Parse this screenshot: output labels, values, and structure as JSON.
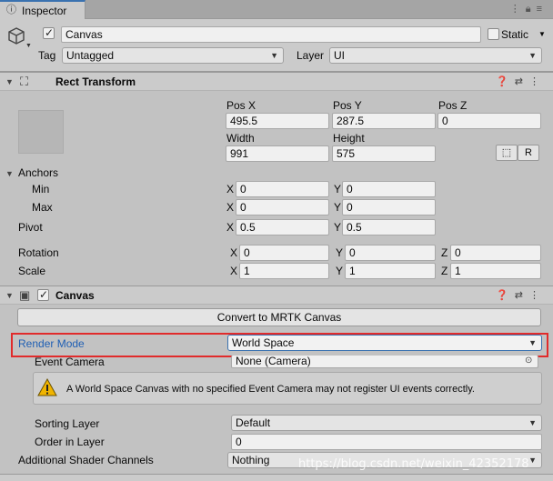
{
  "tab": {
    "label": "Inspector",
    "icon": "info-icon"
  },
  "header": {
    "object_name": "Canvas",
    "static_label": "Static",
    "tag_label": "Tag",
    "tag_value": "Untagged",
    "layer_label": "Layer",
    "layer_value": "UI"
  },
  "rect_transform": {
    "title": "Rect Transform",
    "pos_x_label": "Pos X",
    "pos_y_label": "Pos Y",
    "pos_z_label": "Pos Z",
    "pos_x": "495.5",
    "pos_y": "287.5",
    "pos_z": "0",
    "width_label": "Width",
    "height_label": "Height",
    "width": "991",
    "height": "575",
    "raw_button": "R",
    "anchors_label": "Anchors",
    "min_label": "Min",
    "max_label": "Max",
    "min_x": "0",
    "min_y": "0",
    "max_x": "0",
    "max_y": "0",
    "pivot_label": "Pivot",
    "pivot_x": "0.5",
    "pivot_y": "0.5",
    "rotation_label": "Rotation",
    "rot_x": "0",
    "rot_y": "0",
    "rot_z": "0",
    "scale_label": "Scale",
    "scale_x": "1",
    "scale_y": "1",
    "scale_z": "1",
    "x": "X",
    "y": "Y",
    "z": "Z"
  },
  "canvas": {
    "title": "Canvas",
    "convert_button": "Convert to MRTK Canvas",
    "render_mode_label": "Render Mode",
    "render_mode_value": "World Space",
    "event_camera_label": "Event Camera",
    "event_camera_value": "None (Camera)",
    "warning": "A World Space Canvas with no specified Event Camera may not register UI events correctly.",
    "sorting_layer_label": "Sorting Layer",
    "sorting_layer_value": "Default",
    "order_label": "Order in Layer",
    "order_value": "0",
    "shader_label": "Additional Shader Channels",
    "shader_value": "Nothing"
  },
  "watermark": "https://blog.csdn.net/weixin_42352178",
  "colors": {
    "accent": "#3a72b0",
    "highlight": "#e12b2b",
    "link_label": "#1f5fb4"
  }
}
